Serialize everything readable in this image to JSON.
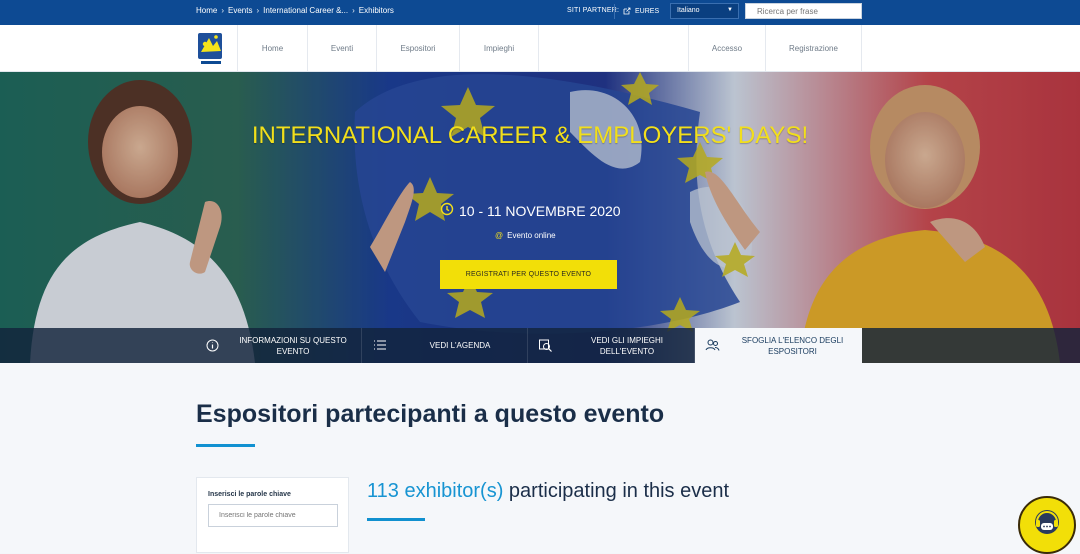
{
  "topbar": {
    "breadcrumb": [
      "Home",
      "Events",
      "International Career &...",
      "Exhibitors"
    ],
    "partner_label": "SITI PARTNER:",
    "partner_button": "EURES",
    "language": "Italiano",
    "search_placeholder": "Ricerca per frase"
  },
  "nav": {
    "logo_text": "EURES",
    "items": [
      "Home",
      "Eventi",
      "Espositori",
      "Impieghi"
    ],
    "account_items": [
      "Accesso",
      "Registrazione"
    ]
  },
  "hero": {
    "title": "INTERNATIONAL CAREER & EMPLOYERS' DAYS!",
    "date": "10 - 11 NOVEMBRE 2020",
    "location": "Evento online",
    "register_button": "REGISTRATI PER QUESTO EVENTO"
  },
  "tabs": [
    {
      "label": "INFORMAZIONI SU QUESTO EVENTO",
      "icon": "info-icon"
    },
    {
      "label": "VEDI L'AGENDA",
      "icon": "list-icon"
    },
    {
      "label": "VEDI GLI IMPIEGHI DELL'EVENTO",
      "icon": "search-job-icon"
    },
    {
      "label": "SFOGLIA L'ELENCO DEGLI ESPOSITORI",
      "icon": "users-icon"
    }
  ],
  "content": {
    "title": "Espositori partecipanti a questo evento",
    "filter_label": "Inserisci le parole chiave",
    "filter_placeholder": "Inserisci le parole chiave",
    "count": "113 exhibitor(s)",
    "count_suffix": " participating in this event"
  },
  "colors": {
    "topbar": "#0d4a93",
    "accent_yellow": "#f2df08",
    "accent_blue": "#1794d2"
  }
}
